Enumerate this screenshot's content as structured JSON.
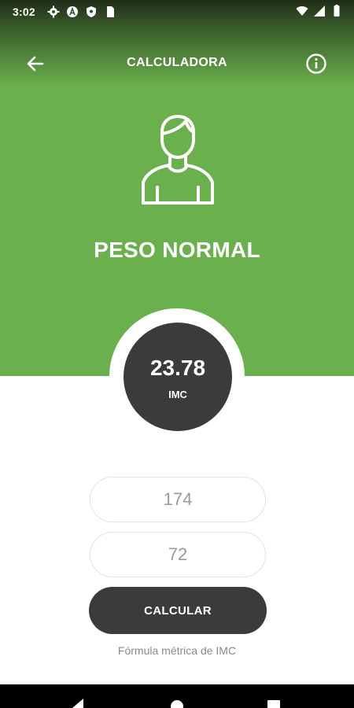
{
  "status_bar": {
    "time": "3:02",
    "icons": [
      "gear-icon",
      "a-badge-icon",
      "shield-icon",
      "sim-card-icon",
      "wifi-icon",
      "signal-icon",
      "battery-icon"
    ]
  },
  "app_bar": {
    "title": "CALCULADORA",
    "back_icon": "arrow-left-icon",
    "info_icon": "info-icon"
  },
  "result": {
    "category": "PESO NORMAL",
    "imc_value": "23.78",
    "imc_label": "IMC",
    "icon": "person-icon"
  },
  "form": {
    "height_value": "174",
    "weight_value": "72",
    "calculate_label": "CALCULAR",
    "note": "Fórmula métrica de IMC"
  },
  "nav_bar": {
    "icons": [
      "nav-back-icon",
      "nav-home-icon",
      "nav-recent-icon"
    ]
  },
  "colors": {
    "primary_green": "#6ab04c",
    "dark": "#3b3b3b",
    "placeholder_gray": "#9a9a9a"
  }
}
